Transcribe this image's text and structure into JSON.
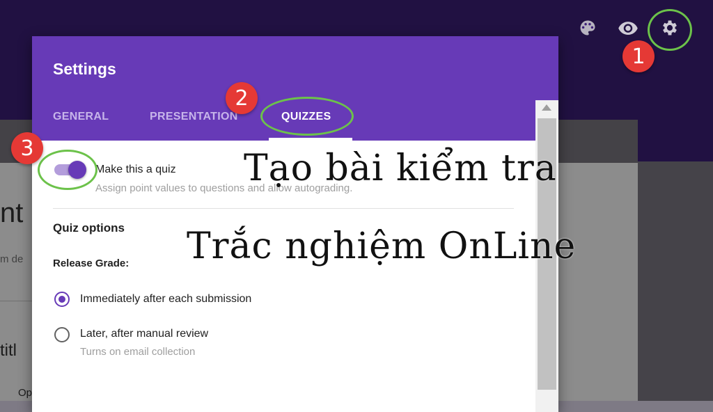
{
  "toolbar": {
    "icons": [
      "palette-icon",
      "eye-icon",
      "gear-icon"
    ]
  },
  "background_fragments": {
    "title_partial": "nt",
    "desc_partial": "m de",
    "question_partial": "titl",
    "option_partial": "Op"
  },
  "dialog": {
    "title": "Settings",
    "tabs": [
      {
        "label": "GENERAL"
      },
      {
        "label": "PRESENTATION"
      },
      {
        "label": "QUIZZES"
      }
    ],
    "quiz_toggle": {
      "label": "Make this a quiz",
      "description": "Assign point values to questions and allow autograding."
    },
    "quiz_options": {
      "heading": "Quiz options",
      "release_grade_label": "Release Grade:",
      "options": [
        {
          "label": "Immediately after each submission",
          "selected": true
        },
        {
          "label": "Later, after manual review",
          "sublabel": "Turns on email collection",
          "selected": false
        }
      ]
    }
  },
  "annotations": {
    "badges": [
      "1",
      "2",
      "3"
    ],
    "line1": "Tạo bài kiểm tra",
    "line2": "Trắc nghiệm OnLine"
  },
  "colors": {
    "header_purple": "#673ab7",
    "topbar": "#3d1f78",
    "ring_green": "#6cc24a",
    "badge_red": "#e53935"
  }
}
